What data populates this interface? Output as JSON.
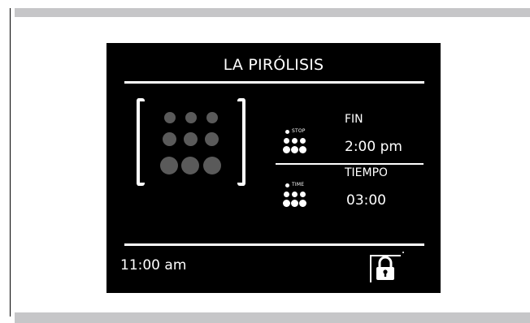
{
  "screen": {
    "title": "LA PIRÓLISIS",
    "end_time": {
      "icon_caption": "STOP",
      "label": "FIN",
      "value": "2:00 pm"
    },
    "duration": {
      "icon_caption": "TIME",
      "label": "TIEMPO",
      "value": "03:00"
    },
    "clock": "11:00 am",
    "icons": {
      "burner_grid": "burner-dots-icon",
      "stop": "stop-dots-icon",
      "time": "time-dots-icon",
      "lock": "padlock-icon"
    }
  },
  "colors": {
    "screen_background": "#000000",
    "foreground": "#ffffff",
    "inactive_dot": "#5a5a5a",
    "page_bar": "#c6c6c8"
  }
}
